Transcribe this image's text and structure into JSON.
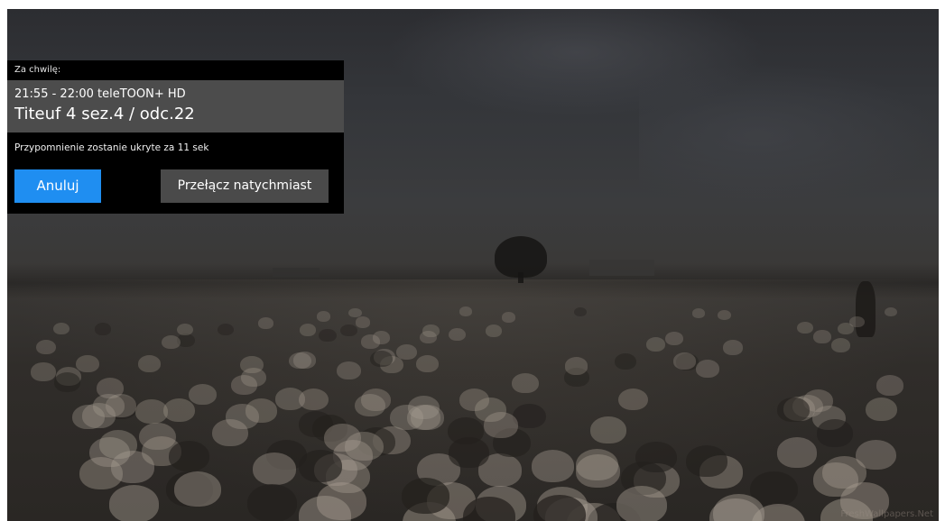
{
  "reminder": {
    "header_label": "Za chwilę:",
    "program_time": "21:55 - 22:00 teleTOON+ HD",
    "program_title": "Titeuf 4 sez.4 / odc.22",
    "countdown_text": "Przypomnienie zostanie ukryte za 11 sek",
    "cancel_label": "Anuluj",
    "switch_label": "Przełącz natychmiast"
  },
  "background": {
    "watermark": "FreshWallpapers.Net"
  },
  "colors": {
    "accent_button": "#1f8ef1",
    "secondary_button": "#4a4a4a",
    "program_band": "#4c4c4c",
    "panel": "#000000"
  }
}
